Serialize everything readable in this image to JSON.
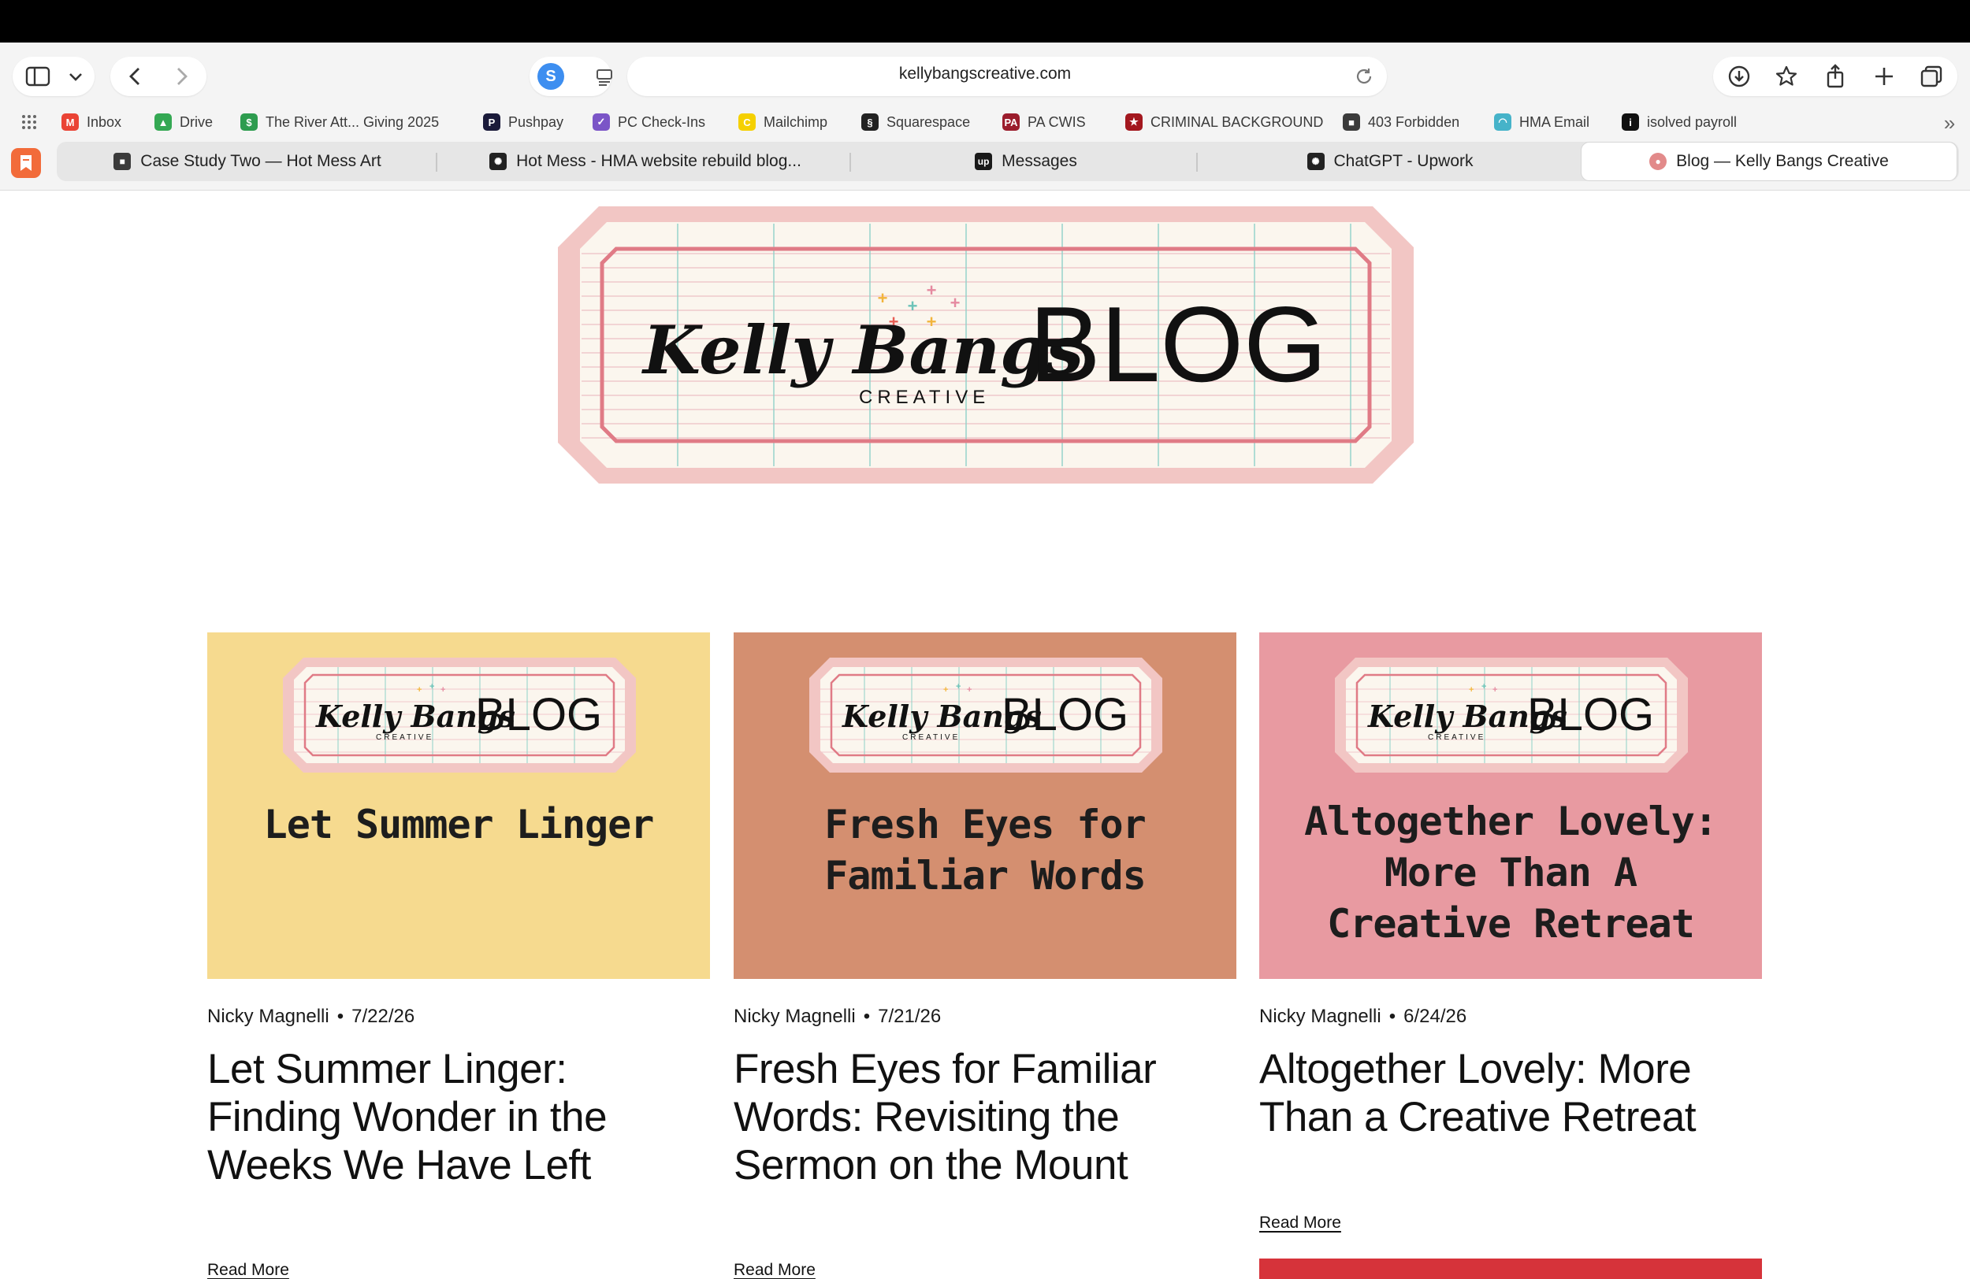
{
  "browser": {
    "url": "kellybangscreative.com",
    "bookmarks": [
      {
        "label": "Inbox",
        "icon": "gmail-icon",
        "color": "#ea4335",
        "glyph": "M"
      },
      {
        "label": "Drive",
        "icon": "drive-icon",
        "color": "#34a853",
        "glyph": "▲"
      },
      {
        "label": "The River Att... Giving 2025",
        "icon": "money-icon",
        "color": "#2e9c4f",
        "glyph": "$"
      },
      {
        "label": "Pushpay",
        "icon": "pushpay-icon",
        "color": "#1a1a3a",
        "glyph": "P"
      },
      {
        "label": "PC Check-Ins",
        "icon": "checkin-icon",
        "color": "#7b55c7",
        "glyph": "✓"
      },
      {
        "label": "Mailchimp",
        "icon": "mailchimp-icon",
        "color": "#f5d000",
        "glyph": "C"
      },
      {
        "label": "Squarespace",
        "icon": "squarespace-icon",
        "color": "#222222",
        "glyph": "§"
      },
      {
        "label": "PA CWIS",
        "icon": "pa-icon",
        "color": "#9b1c2c",
        "glyph": "PA"
      },
      {
        "label": "CRIMINAL BACKGROUND",
        "icon": "police-icon",
        "color": "#a3171e",
        "glyph": "★"
      },
      {
        "label": "403 Forbidden",
        "icon": "cube-icon",
        "color": "#3b3b3b",
        "glyph": "■"
      },
      {
        "label": "HMA Email",
        "icon": "hma-icon",
        "color": "#46b3c9",
        "glyph": "◠"
      },
      {
        "label": "isolved payroll",
        "icon": "isolved-icon",
        "color": "#111111",
        "glyph": "i"
      }
    ],
    "tabs": [
      {
        "label": "Case Study Two — Hot Mess Art",
        "icon": "cube-icon",
        "color": "#3b3b3b",
        "glyph": "■",
        "active": false
      },
      {
        "label": "Hot Mess - HMA website rebuild blog...",
        "icon": "chatgpt-icon",
        "color": "#222222",
        "glyph": "✺",
        "active": false
      },
      {
        "label": "Messages",
        "icon": "upwork-icon",
        "color": "#1a1a1a",
        "glyph": "up",
        "active": false
      },
      {
        "label": "ChatGPT - Upwork",
        "icon": "chatgpt-icon",
        "color": "#222222",
        "glyph": "✺",
        "active": false
      },
      {
        "label": "Blog — Kelly Bangs Creative",
        "icon": "kelly-icon",
        "color": "#e28a8a",
        "glyph": "●",
        "active": true
      }
    ]
  },
  "hero": {
    "logo_script": "Kelly Bangs",
    "logo_sub": "CREATIVE",
    "blog_word": "BLOG"
  },
  "posts": [
    {
      "thumb_bg": "#f6da8f",
      "thumb_title": "Let Summer Linger",
      "author": "Nicky Magnelli",
      "date": "7/22/26",
      "title": "Let Summer Linger: Finding Wonder in the Weeks We Have Left",
      "read_more": "Read More"
    },
    {
      "thumb_bg": "#d48f70",
      "thumb_title": "Fresh Eyes for Familiar Words",
      "author": "Nicky Magnelli",
      "date": "7/21/26",
      "title": "Fresh Eyes for Familiar Words: Revisiting the Sermon on the Mount",
      "read_more": "Read More"
    },
    {
      "thumb_bg": "#e89aa1",
      "thumb_title": "Altogether Lovely: More Than A Creative Retreat",
      "author": "Nicky Magnelli",
      "date": "6/24/26",
      "title": "Altogether Lovely: More Than a Creative Retreat",
      "read_more": "Read More"
    }
  ],
  "colors": {
    "hero_frame": "#f2c6c4",
    "hero_inner_border": "#e07b86",
    "paper": "#fbf6ee",
    "ruled_line": "#f0c8cc",
    "grid_line": "#8fd1c8",
    "next_card_red": "#d6333a"
  }
}
